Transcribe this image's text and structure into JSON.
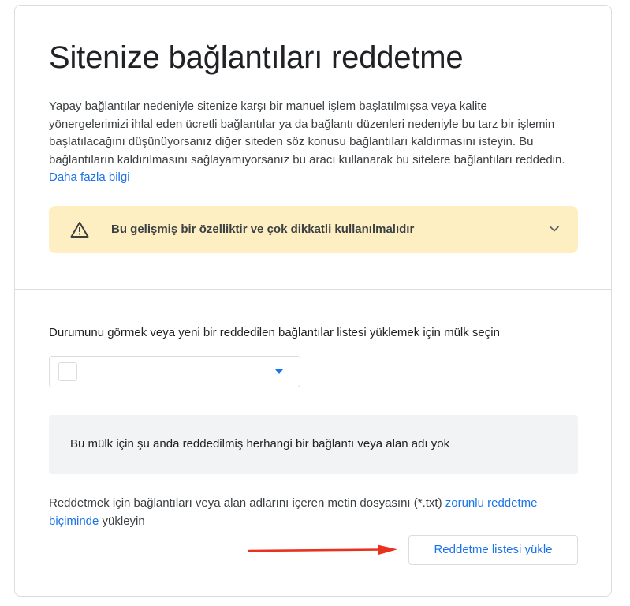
{
  "page": {
    "title": "Sitenize bağlantıları reddetme"
  },
  "intro": {
    "text": "Yapay bağlantılar nedeniyle sitenize karşı bir manuel işlem başlatılmışsa veya kalite yönergelerimizi ihlal eden ücretli bağlantılar ya da bağlantı düzenleri nedeniyle bu tarz bir işlemin başlatılacağını düşünüyorsanız diğer siteden söz konusu bağlantıları kaldırmasını isteyin. Bu bağlantıların kaldırılmasını sağlayamıyorsanız bu aracı kullanarak bu sitelere bağlantıları reddedin. ",
    "learn_more_link": "Daha fazla bilgi"
  },
  "warning": {
    "icon": "warning-triangle-icon",
    "text": "Bu gelişmiş bir özelliktir ve çok dikkatli kullanılmalıdır",
    "expand_icon": "chevron-down-icon",
    "background_color": "#feefc3"
  },
  "property_section": {
    "prompt": "Durumunu görmek veya yeni bir reddedilen bağlantılar listesi yüklemek için mülk seçin",
    "select": {
      "selected_value": "",
      "dropdown_icon": "caret-down-icon",
      "accent_color": "#1a73e8"
    },
    "empty_state": "Bu mülk için şu anda reddedilmiş herhangi bir bağlantı veya alan adı yok",
    "upload_note": {
      "text_before": "Reddetmek için bağlantıları veya alan adlarını içeren metin dosyasını (*.txt) ",
      "link": "zorunlu reddetme biçiminde",
      "text_after": " yükleyin"
    },
    "upload_button": "Reddetme listesi yükle",
    "annotation_arrow": {
      "icon": "red-arrow-icon",
      "color": "#e8321e"
    }
  },
  "colors": {
    "link": "#1a73e8",
    "border": "#dadce0",
    "empty_bg": "#f1f3f4"
  }
}
